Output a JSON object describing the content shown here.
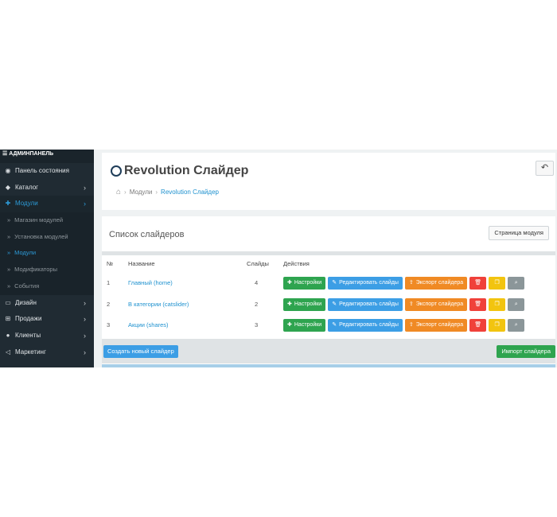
{
  "sidebar": {
    "header": "АДМИНПАНЕЛЬ",
    "items": [
      {
        "label": "Панель состояния",
        "icon": "dashboard-icon",
        "glyph": "◉"
      },
      {
        "label": "Каталог",
        "icon": "tag-icon",
        "glyph": "◆"
      },
      {
        "label": "Модули",
        "icon": "puzzle-icon",
        "glyph": "✚"
      },
      {
        "label": "Дизайн",
        "icon": "monitor-icon",
        "glyph": "▭"
      },
      {
        "label": "Продажи",
        "icon": "cart-icon",
        "glyph": "⊞"
      },
      {
        "label": "Клиенты",
        "icon": "user-icon",
        "glyph": "●"
      },
      {
        "label": "Маркетинг",
        "icon": "share-icon",
        "glyph": "◁"
      }
    ],
    "subitems": [
      {
        "label": "Магазин модулей"
      },
      {
        "label": "Установка модулей"
      },
      {
        "label": "Модули"
      },
      {
        "label": "Модификаторы"
      },
      {
        "label": "События"
      }
    ],
    "chevron": "›",
    "sub_dot": "»"
  },
  "header": {
    "title": "Revolution Слайдер",
    "back_glyph": "↶",
    "breadcrumb": {
      "home_glyph": "⌂",
      "sep": "›",
      "items": [
        "Модули",
        "Revolution Слайдер"
      ]
    }
  },
  "panel": {
    "title": "Список слайдеров",
    "module_page_button": "Страница модуля",
    "table": {
      "headers": {
        "num": "№",
        "name": "Название",
        "slides": "Слайды",
        "actions": "Действия"
      },
      "rows": [
        {
          "num": "1",
          "name": "Главный (home)",
          "slides": "4"
        },
        {
          "num": "2",
          "name": "В категории (catslider)",
          "slides": "2"
        },
        {
          "num": "3",
          "name": "Акции (shares)",
          "slides": "3"
        }
      ]
    },
    "actions": {
      "settings": "Настройки",
      "edit_slides": "Редактировать слайды",
      "export": "Экспорт слайдера",
      "settings_glyph": "✚",
      "edit_glyph": "✎",
      "export_glyph": "⇪",
      "delete_glyph": "🗑",
      "copy_glyph": "❐",
      "preview_glyph": "⌕"
    },
    "create_button": "Создать новый слайдер",
    "import_button": "Импорт слайдера"
  },
  "colors": {
    "sidebar_bg": "#202b33",
    "accent_blue": "#1e91cf",
    "green": "#2ea44f",
    "blue": "#3c9ee5",
    "orange": "#f08a24",
    "red": "#f0413a",
    "yellow": "#f2c40f",
    "gray": "#8b9699"
  }
}
